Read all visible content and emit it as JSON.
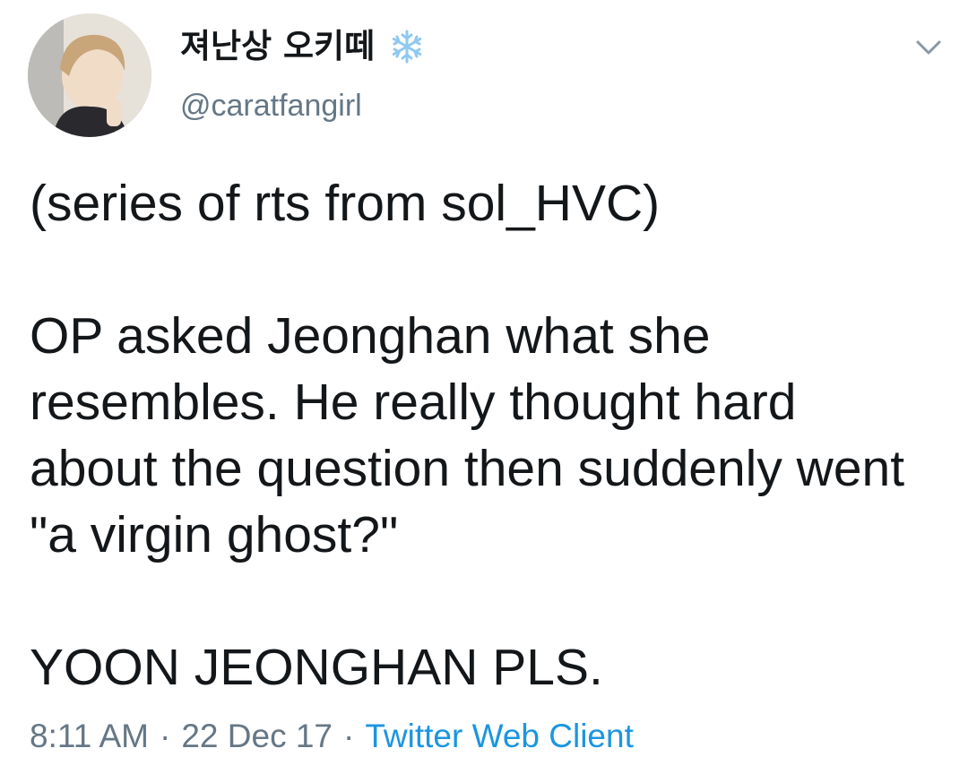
{
  "user": {
    "display_name": "져난상 오키떼",
    "handle": "@caratfangirl",
    "name_emoji_icon": "snowflake-icon"
  },
  "tweet": {
    "paragraphs": [
      "(series of rts from sol_HVC)",
      "OP asked Jeonghan what she resembles. He really thought hard about the question then suddenly went \"a virgin ghost?\"",
      "YOON JEONGHAN PLS."
    ],
    "time": "8:11 AM",
    "separator": "·",
    "date": "22 Dec 17",
    "client": "Twitter Web Client"
  },
  "colors": {
    "text": "#14171a",
    "secondary": "#657786",
    "link": "#1b95e0",
    "snowflake": "#8fc8f0"
  },
  "icons": {
    "menu": "chevron-down-icon",
    "avatar": "avatar"
  }
}
